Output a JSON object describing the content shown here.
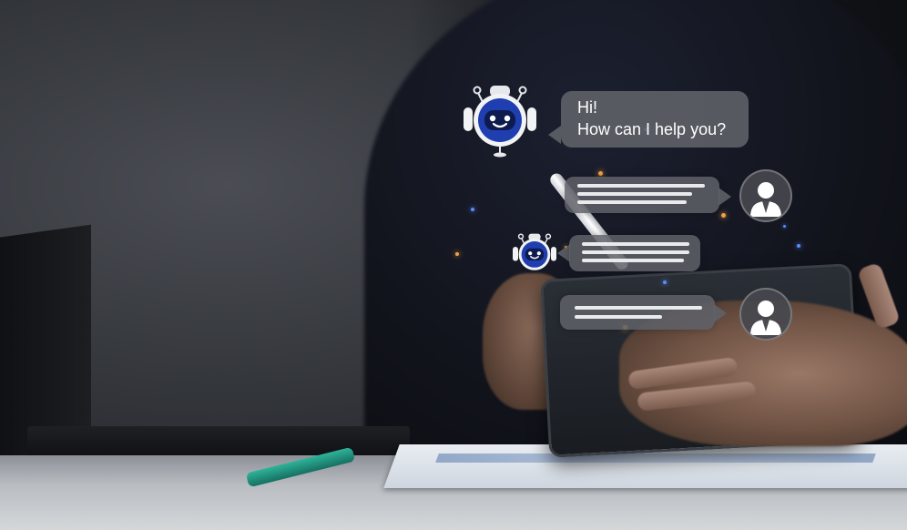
{
  "chat": {
    "bot_greeting_line1": "Hi!",
    "bot_greeting_line2": "How can I help you?"
  },
  "icons": {
    "bot_avatar": "robot-headset-icon",
    "user_avatar": "person-suit-icon"
  },
  "colors": {
    "bot_blue": "#1f3fb0",
    "bubble_gray": "#606369",
    "glow_orange": "#f2a046",
    "glow_blue": "#5b8cff"
  }
}
